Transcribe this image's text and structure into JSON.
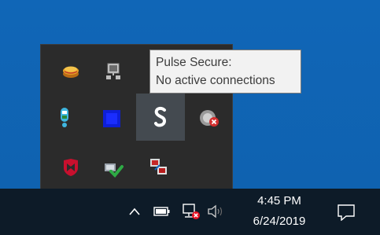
{
  "tooltip": {
    "title": "Pulse Secure:",
    "status": "No active connections"
  },
  "tray_icons": [
    {
      "name": "stack-app-icon"
    },
    {
      "name": "network-computer-icon"
    },
    {
      "name": "bluetooth-app-icon"
    },
    {
      "name": "blue-square-app-icon"
    },
    {
      "name": "pulse-secure-icon"
    },
    {
      "name": "disconnected-error-icon"
    },
    {
      "name": "mcafee-shield-icon"
    },
    {
      "name": "checkmark-sync-icon"
    },
    {
      "name": "remote-desktop-icon"
    }
  ],
  "taskbar": {
    "time": "4:45 PM",
    "date": "6/24/2019"
  },
  "colors": {
    "desktop": "#1068b8",
    "taskbar": "#0d1b28",
    "flyout": "#2b2b2b",
    "tooltip_bg": "#f2f2f2"
  }
}
